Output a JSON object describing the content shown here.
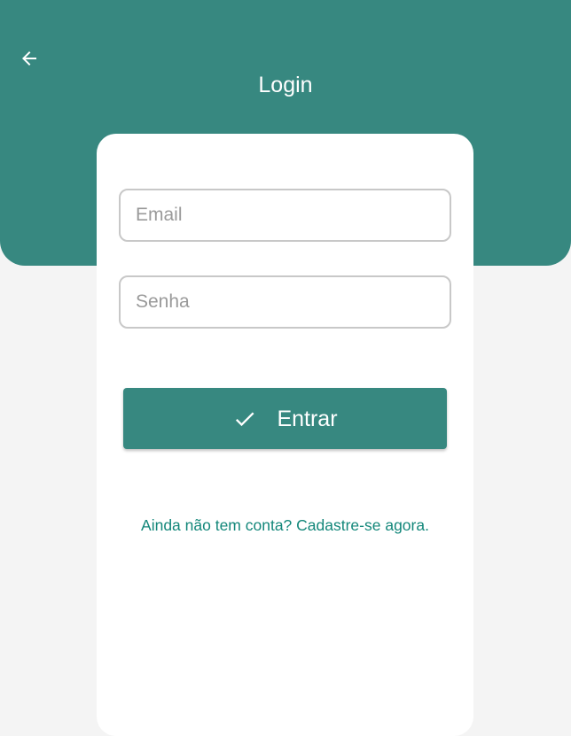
{
  "header": {
    "title": "Login",
    "back_icon": "arrow-left-icon"
  },
  "form": {
    "email_placeholder": "Email",
    "email_value": "",
    "password_placeholder": "Senha",
    "password_value": "",
    "submit_label": "Entrar",
    "submit_icon": "check-icon",
    "signup_link": "Ainda não tem conta? Cadastre-se agora."
  },
  "colors": {
    "primary": "#378880",
    "link": "#13877a",
    "background": "#f4f4f4",
    "card": "#ffffff",
    "input_border": "#c8c8c8"
  }
}
